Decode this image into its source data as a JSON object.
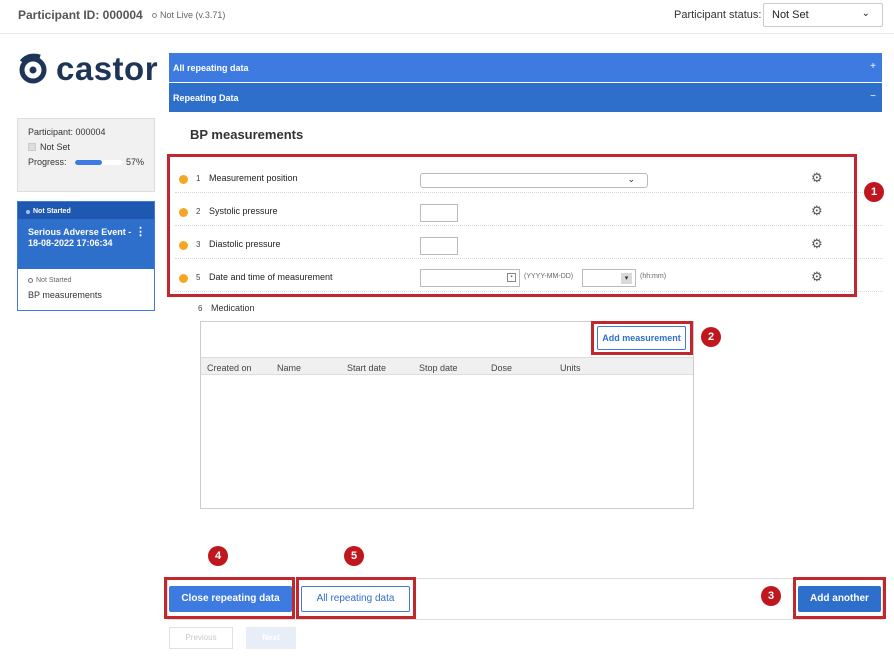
{
  "header": {
    "participant_id": "Participant ID: 000004",
    "live_status": "Not Live (v.3.71)",
    "participant_status_label": "Participant status:",
    "participant_status_value": "Not Set"
  },
  "logo": {
    "text": "castor"
  },
  "participant_panel": {
    "participant": "Participant: 000004",
    "status": "Not Set",
    "progress_label": "Progress:",
    "progress_value": "57%",
    "progress_fraction": 0.57
  },
  "event_card": {
    "state": "Not Started",
    "title": "Serious Adverse Event - 18-08-2022 17:06:34",
    "sub_state": "Not Started",
    "form_name": "BP measurements"
  },
  "bars": {
    "all_repeating": "All repeating data",
    "all_repeating_sign": "+",
    "repeating_data": "Repeating Data",
    "repeating_data_sign": "−"
  },
  "form": {
    "title": "BP measurements",
    "fields": [
      {
        "num": "1",
        "label": "Measurement position"
      },
      {
        "num": "2",
        "label": "Systolic pressure"
      },
      {
        "num": "3",
        "label": "Diastolic pressure"
      },
      {
        "num": "5",
        "label": "Date and time of measurement",
        "date_format": "(YYYY-MM-DD)",
        "time_format": "(hh:mm)"
      }
    ],
    "medication": {
      "num": "6",
      "label": "Medication",
      "add_button": "Add measurement",
      "columns": [
        "Created on",
        "Name",
        "Start date",
        "Stop date",
        "Dose",
        "Units"
      ]
    }
  },
  "annotations": [
    "1",
    "2",
    "3",
    "4",
    "5"
  ],
  "footer": {
    "close_button": "Close repeating data",
    "all_button": "All repeating data",
    "another_button": "Add another",
    "previous": "Previous",
    "next": "Next"
  },
  "colors": {
    "primary": "#3d7be0",
    "primary_dark": "#2f6fcc",
    "highlight": "#c1272d",
    "field_dot": "#f5a623"
  }
}
